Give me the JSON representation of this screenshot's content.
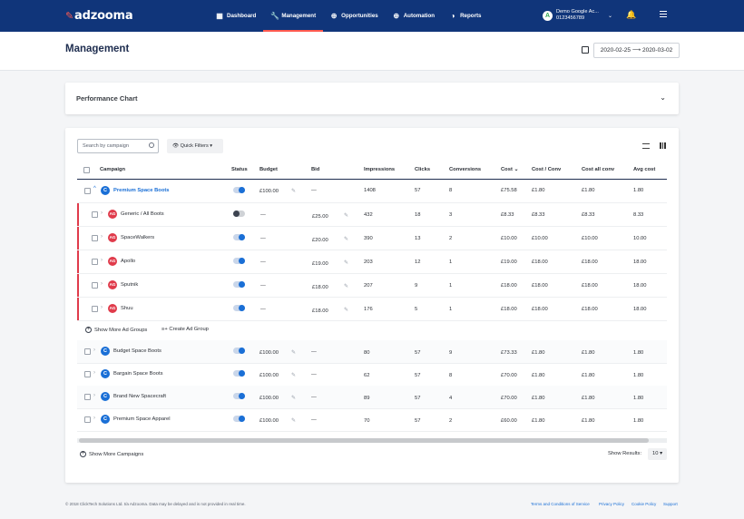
{
  "brand": {
    "name": "adzooma",
    "accent": "#ff5a4f",
    "topbar_color": "#10357a"
  },
  "nav": {
    "items": [
      {
        "label": "Dashboard",
        "icon": "dashboard-icon",
        "active": false
      },
      {
        "label": "Management",
        "icon": "wrench-icon",
        "active": true
      },
      {
        "label": "Opportunities",
        "icon": "plus-circle-icon",
        "active": false
      },
      {
        "label": "Automation",
        "icon": "plus-circle-icon",
        "active": false
      },
      {
        "label": "Reports",
        "icon": "pie-chart-icon",
        "active": false
      }
    ]
  },
  "account": {
    "badge": "A",
    "name": "Demo Google Ac...",
    "id": "0123456789"
  },
  "page": {
    "title": "Management",
    "date_range": "2020-02-25 ⟶ 2020-03-02"
  },
  "performance": {
    "title": "Performance Chart"
  },
  "toolbar": {
    "search_placeholder": "Search by campaign",
    "quick_filters": "Quick Filters ▾"
  },
  "table": {
    "headers": {
      "campaign": "Campaign",
      "status": "Status",
      "budget": "Budget",
      "bid": "Bid",
      "impressions": "Impressions",
      "clicks": "Clicks",
      "conversions": "Conversions",
      "cost": "Cost ⌄",
      "cost_conv": "Cost / Conv",
      "cost_all_conv": "Cost all conv",
      "avg_cost": "Avg cost"
    },
    "expanded_campaign": {
      "badge": "C",
      "name": "Premium Space Boots",
      "enabled": true,
      "budget": "£100.00",
      "bid": "—",
      "impressions": "1408",
      "clicks": "57",
      "conversions": "8",
      "cost": "£75.58",
      "cost_conv": "£1.80",
      "cost_all_conv": "£1.80",
      "avg_cost": "1.80"
    },
    "ad_groups": [
      {
        "badge": "AG",
        "name": "Generic / All Boots",
        "enabled": false,
        "budget": "—",
        "bid": "£25.00",
        "impressions": "432",
        "clicks": "18",
        "conversions": "3",
        "cost": "£8.33",
        "cost_conv": "£8.33",
        "cost_all_conv": "£8.33",
        "avg_cost": "8.33"
      },
      {
        "badge": "AG",
        "name": "SpaceWalkers",
        "enabled": true,
        "budget": "—",
        "bid": "£20.00",
        "impressions": "390",
        "clicks": "13",
        "conversions": "2",
        "cost": "£10.00",
        "cost_conv": "£10.00",
        "cost_all_conv": "£10.00",
        "avg_cost": "10.00"
      },
      {
        "badge": "AG",
        "name": "Apollo",
        "enabled": true,
        "budget": "—",
        "bid": "£19.00",
        "impressions": "203",
        "clicks": "12",
        "conversions": "1",
        "cost": "£19.00",
        "cost_conv": "£18.00",
        "cost_all_conv": "£18.00",
        "avg_cost": "18.00"
      },
      {
        "badge": "AG",
        "name": "Sputnik",
        "enabled": true,
        "budget": "—",
        "bid": "£18.00",
        "impressions": "207",
        "clicks": "9",
        "conversions": "1",
        "cost": "£18.00",
        "cost_conv": "£18.00",
        "cost_all_conv": "£18.00",
        "avg_cost": "18.00"
      },
      {
        "badge": "AG",
        "name": "Shuu",
        "enabled": true,
        "budget": "—",
        "bid": "£18.00",
        "impressions": "176",
        "clicks": "5",
        "conversions": "1",
        "cost": "£18.00",
        "cost_conv": "£18.00",
        "cost_all_conv": "£18.00",
        "avg_cost": "18.00"
      }
    ],
    "show_more_ad_groups": "Show More Ad Groups",
    "create_ad_group": "Create Ad Group",
    "campaigns": [
      {
        "badge": "C",
        "name": "Budget Space Boots",
        "enabled": true,
        "budget": "£100.00",
        "bid": "—",
        "impressions": "80",
        "clicks": "57",
        "conversions": "9",
        "cost": "£73.33",
        "cost_conv": "£1.80",
        "cost_all_conv": "£1.80",
        "avg_cost": "1.80"
      },
      {
        "badge": "C",
        "name": "Bargain Space Boots",
        "enabled": true,
        "budget": "£100.00",
        "bid": "—",
        "impressions": "62",
        "clicks": "57",
        "conversions": "8",
        "cost": "£70.00",
        "cost_conv": "£1.80",
        "cost_all_conv": "£1.80",
        "avg_cost": "1.80"
      },
      {
        "badge": "C",
        "name": "Brand New Spacecraft",
        "enabled": true,
        "budget": "£100.00",
        "bid": "—",
        "impressions": "89",
        "clicks": "57",
        "conversions": "4",
        "cost": "£70.00",
        "cost_conv": "£1.80",
        "cost_all_conv": "£1.80",
        "avg_cost": "1.80"
      },
      {
        "badge": "C",
        "name": "Premium Space Apparel",
        "enabled": true,
        "budget": "£100.00",
        "bid": "—",
        "impressions": "70",
        "clicks": "57",
        "conversions": "2",
        "cost": "£60.00",
        "cost_conv": "£1.80",
        "cost_all_conv": "£1.80",
        "avg_cost": "1.80"
      }
    ],
    "show_more_campaigns": "Show More Campaigns",
    "show_results_label": "Show Results:",
    "show_results_value": "10 ▾"
  },
  "footer": {
    "copyright": "© 2018 ClickTech Solutions Ltd. t/a Adzooma. Data may be delayed and is not provided in real time.",
    "links": [
      "Terms and Conditions of Service",
      "Privacy Policy",
      "Cookie Policy",
      "Support"
    ]
  }
}
